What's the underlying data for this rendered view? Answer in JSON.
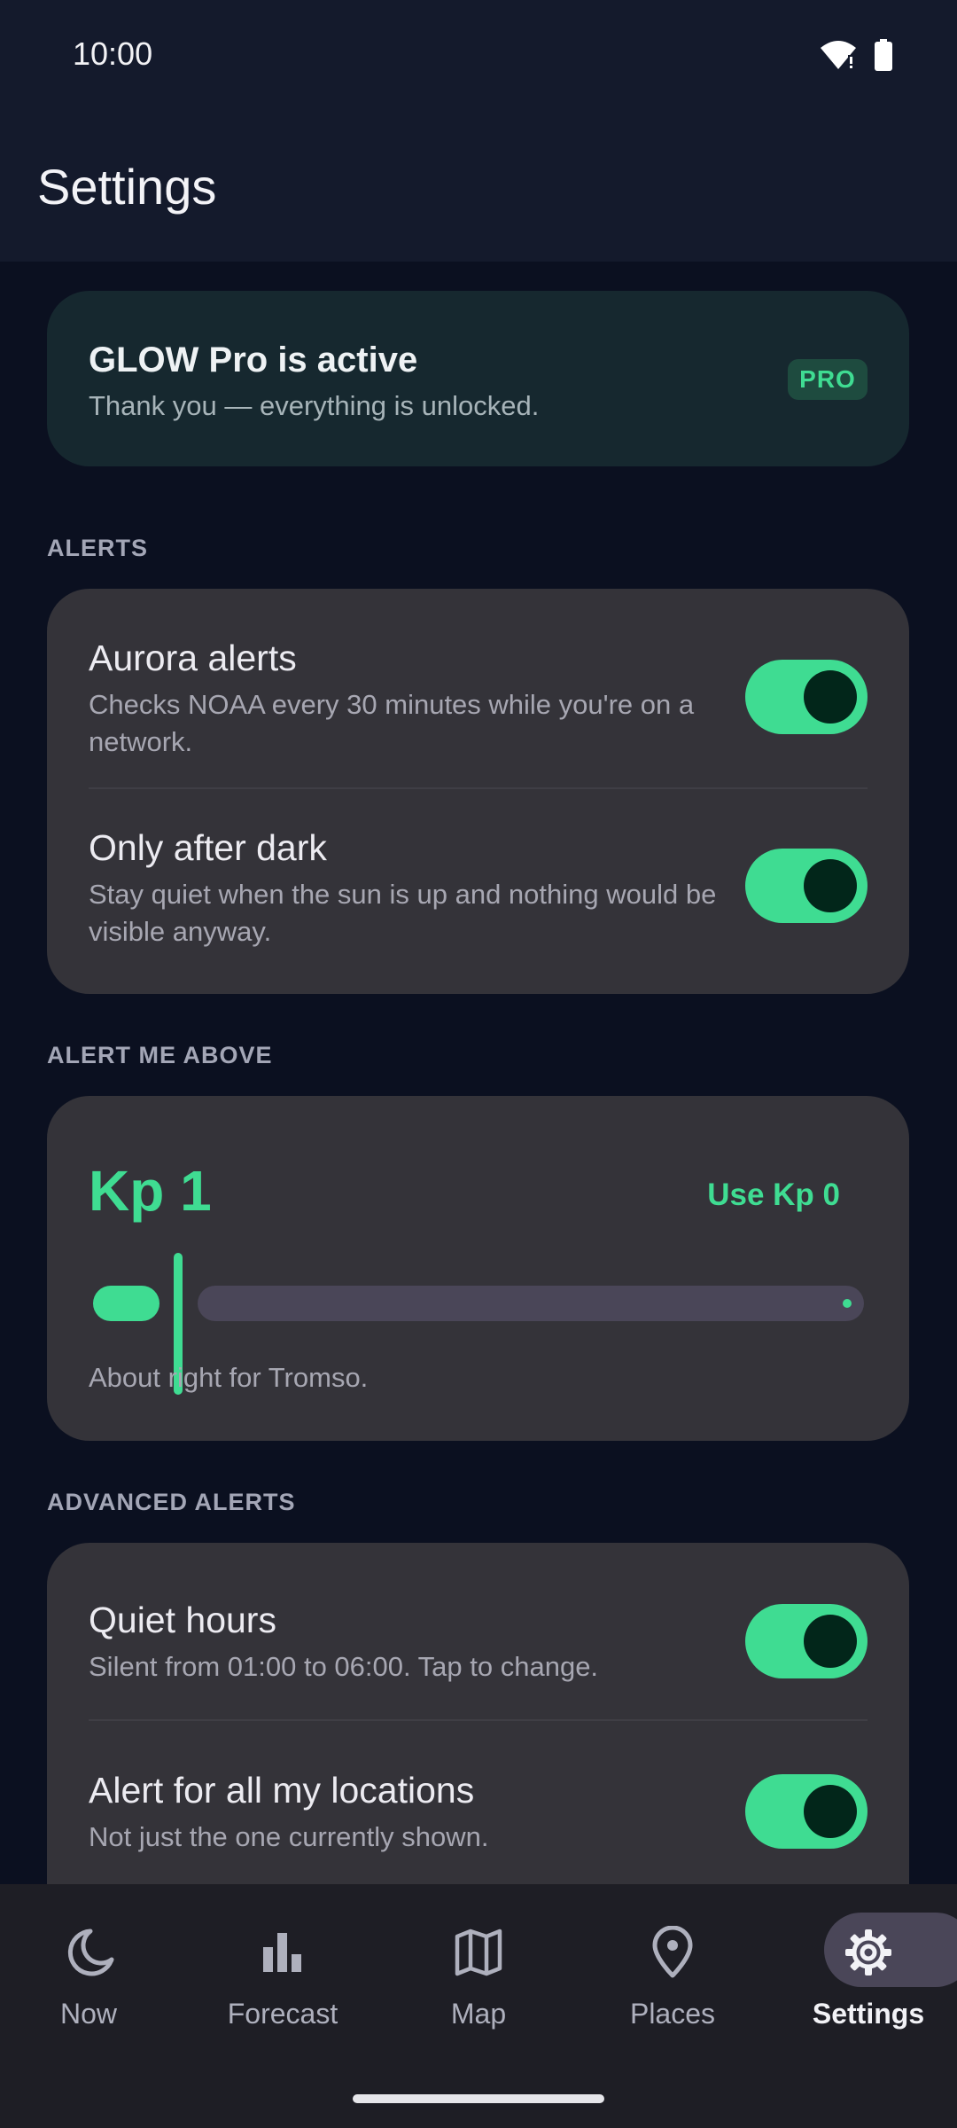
{
  "status_bar": {
    "time": "10:00",
    "icons": [
      "wifi-icon",
      "battery-icon"
    ]
  },
  "page": {
    "title": "Settings"
  },
  "pro_card": {
    "title": "GLOW Pro is active",
    "subtitle": "Thank you — everything is unlocked.",
    "badge": "PRO"
  },
  "sections": {
    "alerts": "ALERTS",
    "alert_me_above": "ALERT ME ABOVE",
    "advanced_alerts": "ADVANCED ALERTS"
  },
  "alerts": {
    "aurora": {
      "title": "Aurora alerts",
      "description": "Checks NOAA every 30 minutes while you're on a network.",
      "enabled": true
    },
    "after_dark": {
      "title": "Only after dark",
      "description": "Stay quiet when the sun is up and nothing would be visible anyway.",
      "enabled": true
    }
  },
  "threshold": {
    "value_label": "Kp 1",
    "reset_label": "Use Kp 0",
    "hint": "About right for Tromso.",
    "slider_value": 1
  },
  "advanced": {
    "quiet_hours": {
      "title": "Quiet hours",
      "description": "Silent from 01:00 to 06:00. Tap to change.",
      "enabled": true
    },
    "all_locations": {
      "title": "Alert for all my locations",
      "description": "Not just the one currently shown.",
      "enabled": true
    }
  },
  "bottom_nav": {
    "items": [
      {
        "label": "Now",
        "icon": "moon-icon"
      },
      {
        "label": "Forecast",
        "icon": "bar-chart-icon"
      },
      {
        "label": "Map",
        "icon": "map-icon"
      },
      {
        "label": "Places",
        "icon": "location-pin-icon"
      },
      {
        "label": "Settings",
        "icon": "gear-icon"
      }
    ],
    "active": "Settings"
  },
  "colors": {
    "accent": "#3fdc92",
    "background": "#0b1020",
    "card": "#343339",
    "pro_card": "#16282f"
  }
}
